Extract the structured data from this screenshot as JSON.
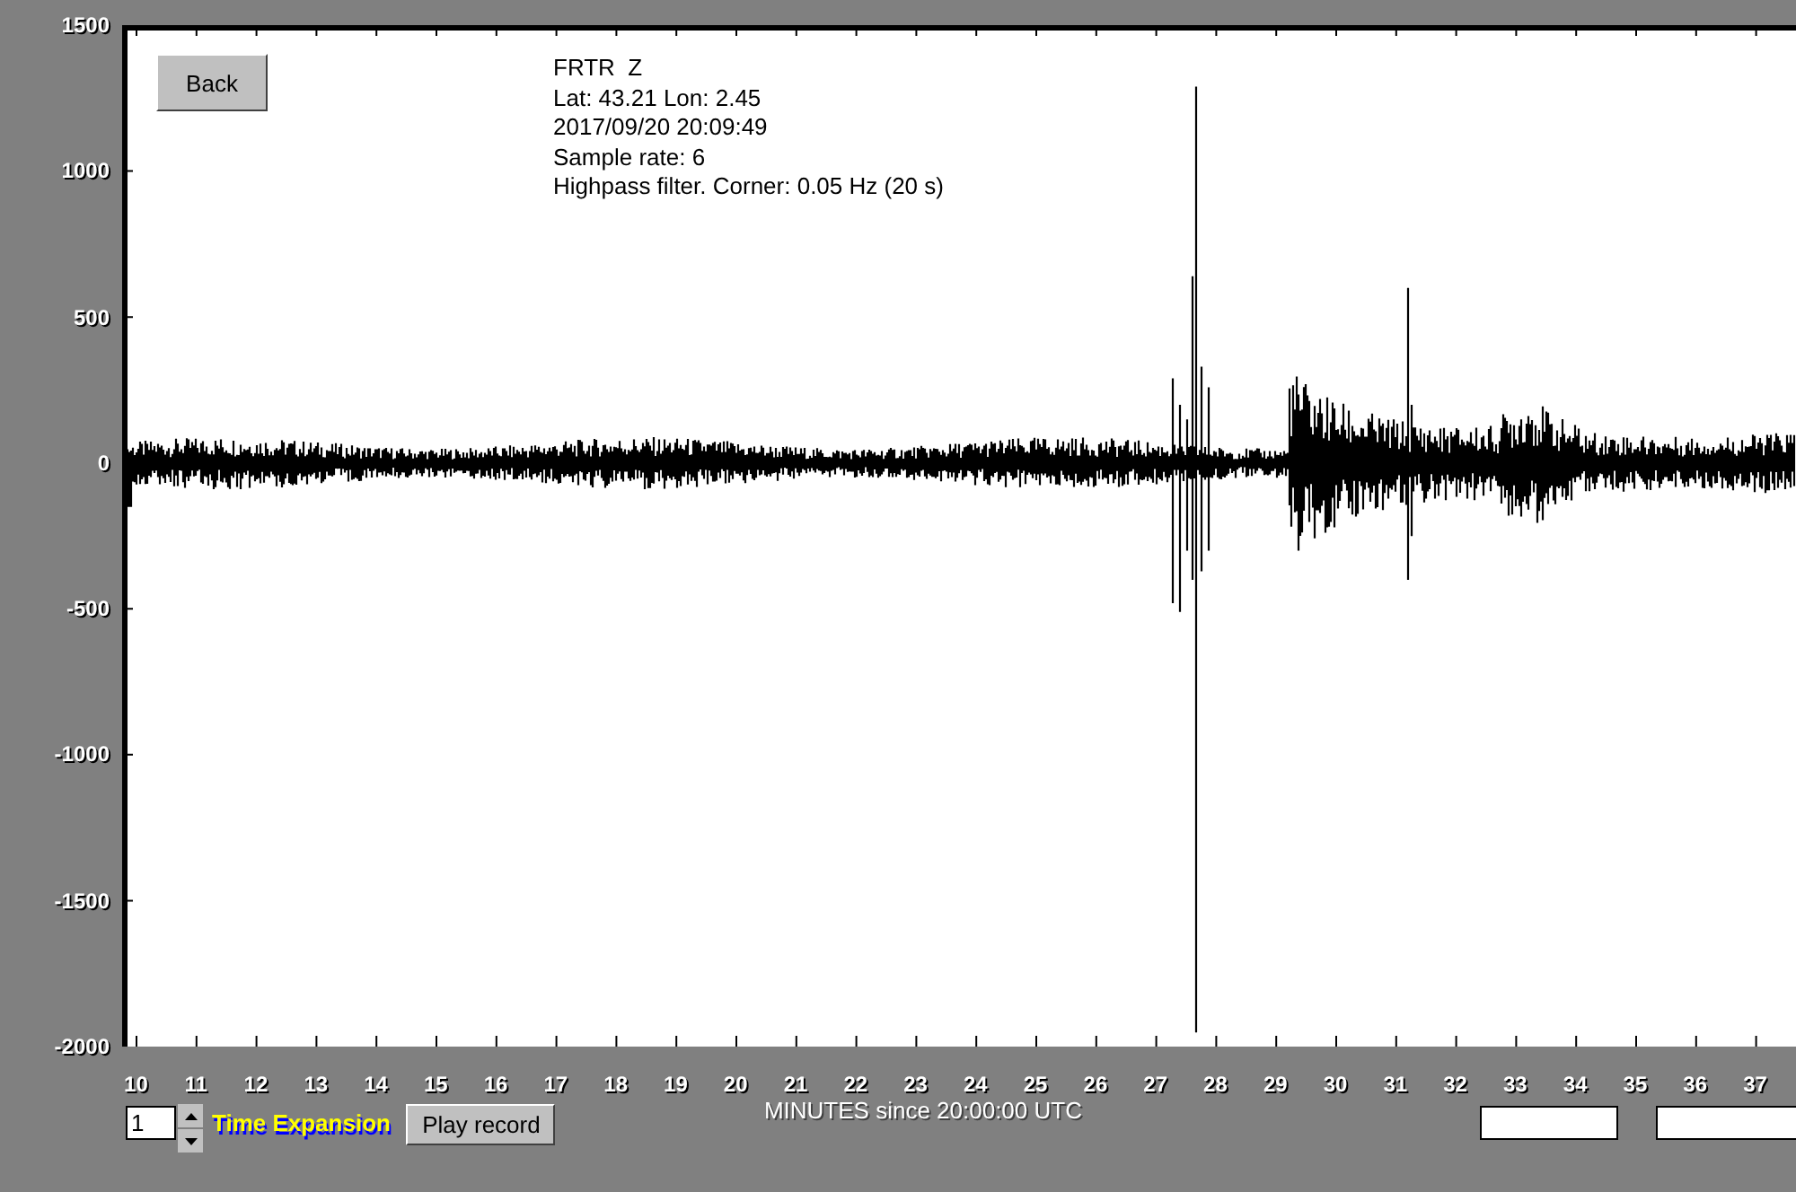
{
  "back_button": "Back",
  "station_info": [
    "FRTR  Z",
    "Lat: 43.21 Lon: 2.45",
    "2017/09/20 20:09:49",
    "Sample rate: 6",
    "Highpass filter. Corner: 0.05 Hz (20 s)"
  ],
  "y_axis_labels": [
    "1500",
    "1000",
    "500",
    "0",
    "-500",
    "-1000",
    "-1500",
    "-2000"
  ],
  "x_axis_labels": [
    "10",
    "11",
    "12",
    "13",
    "14",
    "15",
    "16",
    "17",
    "18",
    "19",
    "20",
    "21",
    "22",
    "23",
    "24",
    "25",
    "26",
    "27",
    "28",
    "29",
    "30",
    "31",
    "32",
    "33",
    "34",
    "35",
    "36",
    "37"
  ],
  "x_axis_title": "MINUTES since 20:00:00 UTC",
  "time_expansion": {
    "value": "1",
    "label": "Time Expansion"
  },
  "play_button": "Play record"
}
